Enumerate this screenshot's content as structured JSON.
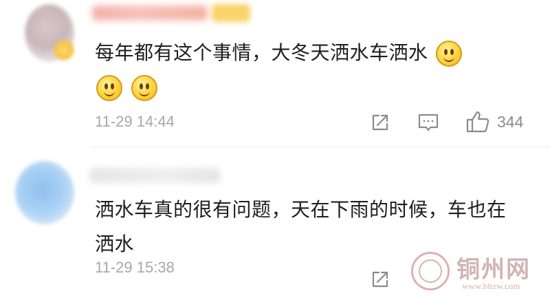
{
  "comments": [
    {
      "text": "每年都有这个事情，大冬天洒水车洒水",
      "emoji": "smile-emoji",
      "time": "11-29 14:44",
      "likes": "344"
    },
    {
      "text": "洒水车真的很有问题，天在下雨的时候，车也在洒水",
      "time": "11-29 15:38"
    }
  ],
  "watermark": {
    "title": "铜州网",
    "url": "www.bltzw.com"
  },
  "icons": {
    "share": "share-icon",
    "reply": "comment-icon",
    "like": "thumbs-up-icon"
  },
  "colors": {
    "text": "#1e1e1e",
    "meta": "#a7a7a7",
    "icon": "#8a8a8a",
    "emoji": "#ffd84a"
  }
}
